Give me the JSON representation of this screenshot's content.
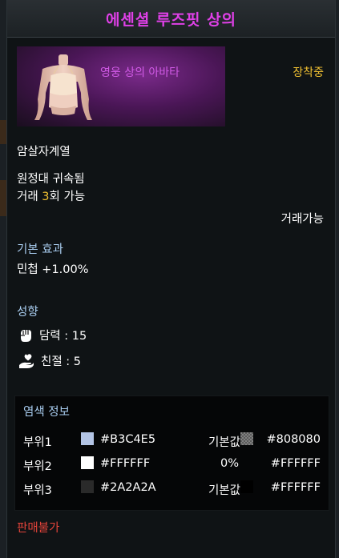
{
  "item": {
    "name": "에센셜 루즈핏 상의",
    "banner_label": "영웅 상의 아바타",
    "equipped_status": "장착중",
    "class_line": "암살자계열",
    "bind_status": "원정대 귀속됨",
    "trade_prefix": "거래 ",
    "trade_count": "3",
    "trade_suffix": "회 가능",
    "tradeable": "거래가능"
  },
  "basic_effect": {
    "heading": "기본 효과",
    "stat": "민첩 +1.00%"
  },
  "tendency": {
    "heading": "성향",
    "items": [
      {
        "label": "담력 : 15",
        "icon": "fist-icon"
      },
      {
        "label": "친절 : 5",
        "icon": "heart-hand-icon"
      }
    ]
  },
  "dye": {
    "heading": "염색 정보",
    "rows": [
      {
        "part": "부위1",
        "color": "#B3C4E5",
        "hex": "#B3C4E5",
        "mid": "기본값",
        "color2": "#808080",
        "hex2": "#808080"
      },
      {
        "part": "부위2",
        "color": "#FFFFFF",
        "hex": "#FFFFFF",
        "mid": "0%",
        "color2": "",
        "hex2": "#FFFFFF"
      },
      {
        "part": "부위3",
        "color": "#2A2A2A",
        "hex": "#2A2A2A",
        "mid": "기본값",
        "color2": "#000000",
        "hex2": "#FFFFFF"
      }
    ]
  },
  "footer": {
    "unsellable": "판매불가"
  },
  "colors": {
    "title": "#e040e8",
    "banner_label": "#d15ae6",
    "equipped": "#f2c232",
    "section_heading": "#a9cdf0",
    "unsellable": "#e2433a"
  }
}
